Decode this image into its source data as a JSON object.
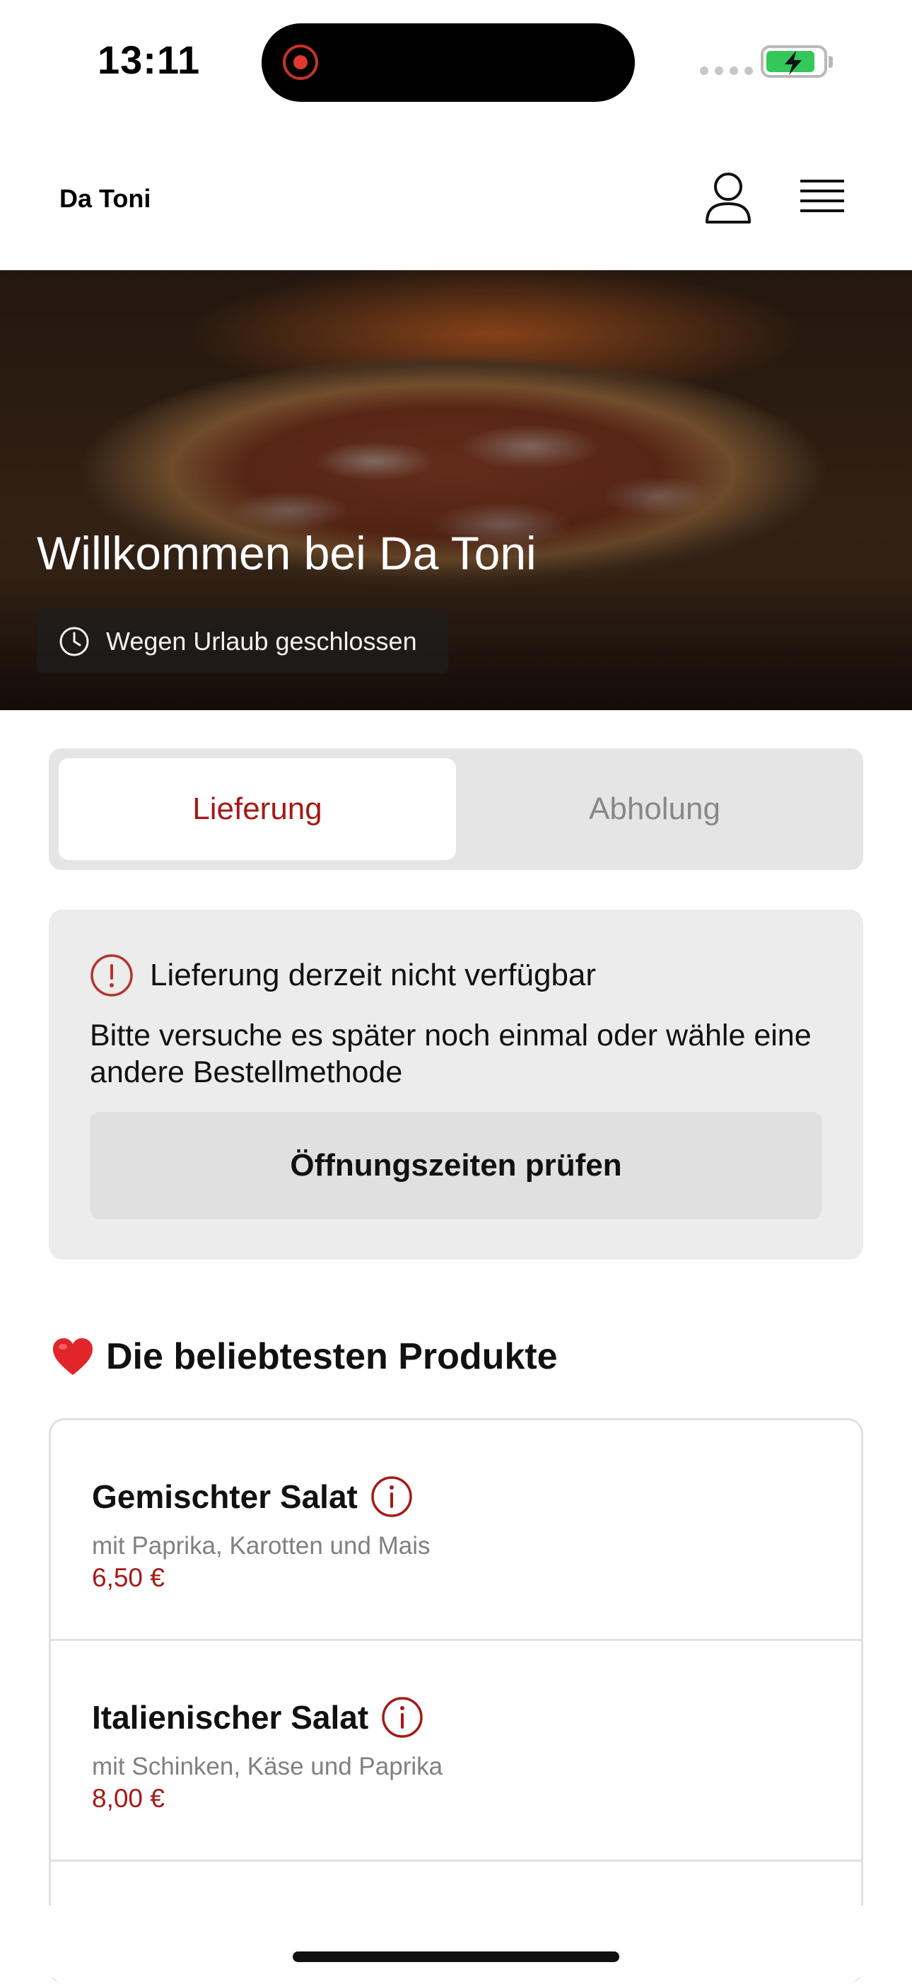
{
  "status_bar": {
    "time": "13:11"
  },
  "header": {
    "brand": "Da Toni",
    "icons": [
      "user-icon",
      "menu-icon"
    ]
  },
  "hero": {
    "title": "Willkommen bei Da Toni",
    "badge": "Wegen Urlaub geschlossen"
  },
  "order_mode": {
    "options": [
      "Lieferung",
      "Abholung"
    ],
    "selected": "Lieferung"
  },
  "notice": {
    "title": "Lieferung derzeit nicht verfügbar",
    "text": "Bitte versuche es später noch einmal oder wähle eine andere Bestellmethode",
    "button": "Öffnungszeiten prüfen"
  },
  "popular": {
    "title": "Die beliebtesten Produkte",
    "products": [
      {
        "name": "Gemischter Salat",
        "desc": "mit Paprika, Karotten und Mais",
        "price": "6,50 €"
      },
      {
        "name": "Italienischer Salat",
        "desc": "mit Schinken, Käse und Paprika",
        "price": "8,00 €"
      }
    ]
  },
  "colors": {
    "accent": "#a41a16",
    "battery": "#34c759",
    "card_bg": "#ececec"
  }
}
